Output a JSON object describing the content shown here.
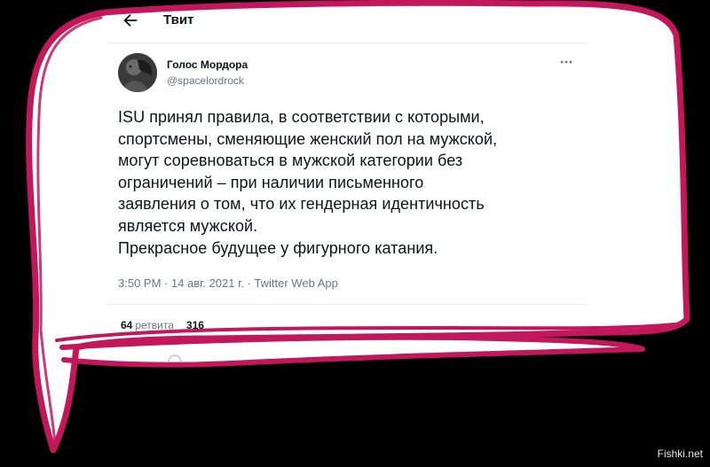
{
  "header": {
    "back_icon": "arrow-left-icon",
    "title": "Твит"
  },
  "tweet": {
    "author_name": "Голос Мордора",
    "author_handle": "@spacelordrock",
    "more_icon": "ellipsis-icon",
    "text": "ISU принял правила, в соответствии с которыми,\nспортсмены, сменяющие женский пол на мужской,\nмогут соревноваться в мужской категории без\nограничений – при наличии письменного\nзаявления о том, что их гендерная идентичность\nявляется мужской.\nПрекрасное будущее у фигурного катания.",
    "meta": "3:50 PM · 14 авг. 2021 г. · Twitter Web App",
    "stats": {
      "retweets_count": "64",
      "retweets_label": "ретвита",
      "likes_count": "316"
    }
  },
  "watermark": "Fishki.net",
  "colors": {
    "background": "#000000",
    "bubble_fill": "#ffffff",
    "bubble_outline": "#c2185b",
    "text": "#0f1419",
    "secondary_text": "#697580"
  }
}
